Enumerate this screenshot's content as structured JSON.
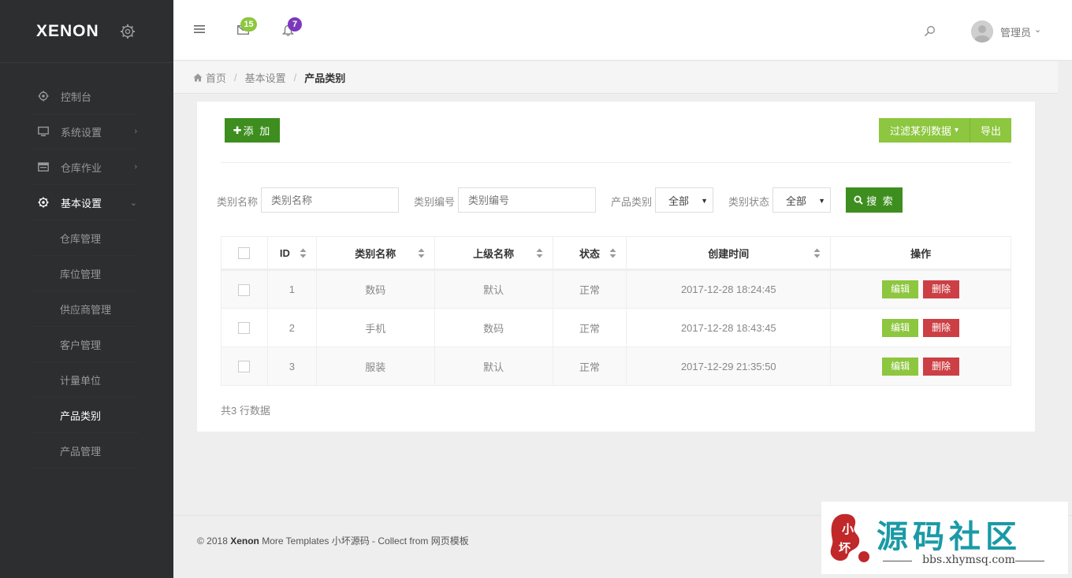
{
  "brand": {
    "logo": "XENON"
  },
  "sidebar": {
    "items": [
      {
        "label": "控制台",
        "icon": "dashboard-gear-icon"
      },
      {
        "label": "系统设置",
        "icon": "monitor-icon",
        "arrow": "›"
      },
      {
        "label": "仓库作业",
        "icon": "warehouse-icon",
        "arrow": "›"
      },
      {
        "label": "基本设置",
        "icon": "settings-gear-icon",
        "arrow": "⌄"
      }
    ],
    "sub_items": [
      "仓库管理",
      "库位管理",
      "供应商管理",
      "客户管理",
      "计量单位",
      "产品类别",
      "产品管理"
    ],
    "active_sub": "产品类别"
  },
  "topbar": {
    "mail_count": "15",
    "notify_count": "7",
    "user_name": "管理员",
    "user_caret": "⌄"
  },
  "breadcrumb": {
    "home": "首页",
    "section": "基本设置",
    "current": "产品类别",
    "sep": "/"
  },
  "toolbar": {
    "add_label": "添 加",
    "add_icon": "✚",
    "filter_label": "过滤某列数据",
    "filter_caret": "▾",
    "export_label": "导出"
  },
  "filters": {
    "category_name_label": "类别名称",
    "category_name_placeholder": "类别名称",
    "category_code_label": "类别编号",
    "category_code_placeholder": "类别编号",
    "product_category_label": "产品类别",
    "product_category_value": "全部",
    "category_status_label": "类别状态",
    "category_status_value": "全部",
    "select_caret": "▼",
    "search_label": "搜 索"
  },
  "table": {
    "headers": [
      "ID",
      "类别名称",
      "上级名称",
      "状态",
      "创建时间",
      "操作"
    ],
    "rows": [
      {
        "id": "1",
        "name": "数码",
        "parent": "默认",
        "status": "正常",
        "created": "2017-12-28 18:24:45"
      },
      {
        "id": "2",
        "name": "手机",
        "parent": "数码",
        "status": "正常",
        "created": "2017-12-28 18:43:45"
      },
      {
        "id": "3",
        "name": "服装",
        "parent": "默认",
        "status": "正常",
        "created": "2017-12-29 21:35:50"
      }
    ],
    "edit_label": "编辑",
    "delete_label": "删除",
    "row_count": "共3 行数据"
  },
  "footer": {
    "copyright": "© 2018 ",
    "brand": "Xenon",
    "rest": " More Templates 小坏源码 - Collect from 网页模板"
  },
  "watermark": {
    "title": "源码社区",
    "url": "bbs.xhymsq.com",
    "seal_text": "小坏"
  },
  "colors": {
    "sidebar_bg": "#2c2e2f",
    "accent_green": "#8dc63f",
    "dark_green": "#3e8e1f",
    "danger_red": "#cc3f44",
    "badge_purple": "#7c38bc",
    "watermark_teal": "#1a9aa6"
  }
}
